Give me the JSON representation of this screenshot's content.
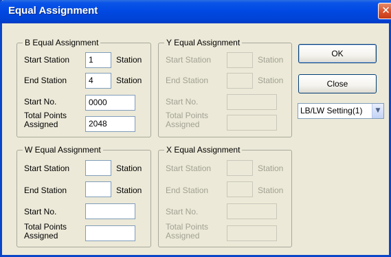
{
  "window": {
    "title": "Equal Assignment",
    "close_glyph": "✕"
  },
  "labels": {
    "start_station": "Start Station",
    "end_station": "End Station",
    "station": "Station",
    "start_no": "Start No.",
    "total_points": "Total Points Assigned"
  },
  "groups": {
    "b": {
      "title": "B Equal Assignment",
      "start_station": "1",
      "end_station": "4",
      "start_no": "0000",
      "total_points": "2048",
      "enabled": true
    },
    "y": {
      "title": "Y Equal Assignment",
      "start_station": "",
      "end_station": "",
      "start_no": "",
      "total_points": "",
      "enabled": false
    },
    "w": {
      "title": "W Equal Assignment",
      "start_station": "",
      "end_station": "",
      "start_no": "",
      "total_points": "",
      "enabled": true
    },
    "x": {
      "title": "X Equal Assignment",
      "start_station": "",
      "end_station": "",
      "start_no": "",
      "total_points": "",
      "enabled": false
    }
  },
  "buttons": {
    "ok": "OK",
    "close": "Close"
  },
  "setting_select": {
    "value": "LB/LW Setting(1)",
    "arrow_icon": "▼"
  }
}
